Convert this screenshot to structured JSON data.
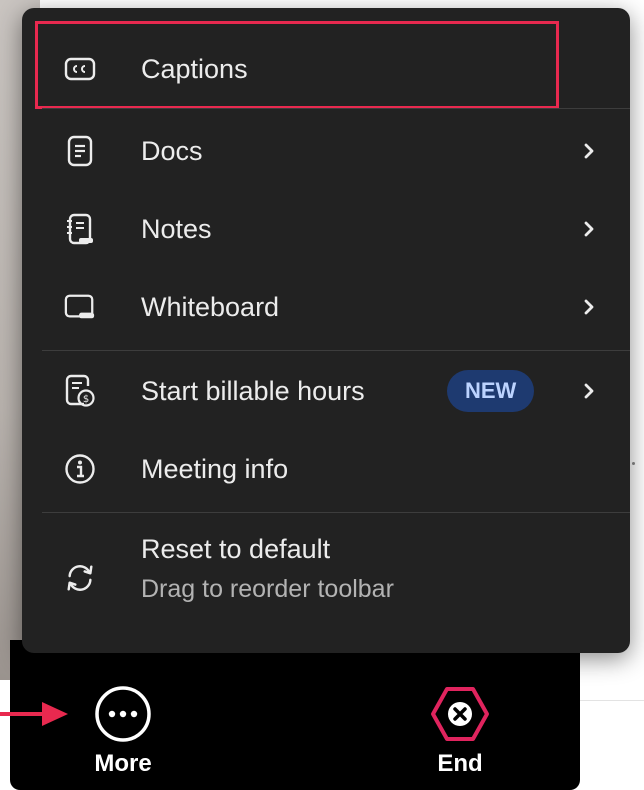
{
  "menu": {
    "items": [
      {
        "label": "Captions",
        "icon": "captions-icon"
      },
      {
        "label": "Docs",
        "icon": "docs-icon"
      },
      {
        "label": "Notes",
        "icon": "notes-icon"
      },
      {
        "label": "Whiteboard",
        "icon": "whiteboard-icon"
      },
      {
        "label": "Start billable hours",
        "icon": "billable-hours-icon",
        "badge": "NEW"
      },
      {
        "label": "Meeting info",
        "icon": "info-icon"
      },
      {
        "label": "Reset to default",
        "sublabel": "Drag to reorder toolbar",
        "icon": "reset-icon"
      }
    ],
    "highlight_color": "#e8294f",
    "badge_color": "#1e3a70"
  },
  "toolbar": {
    "more_label": "More",
    "end_label": "End",
    "end_color": "#e0245e"
  },
  "annotation": {
    "arrow_color": "#e8294f"
  }
}
